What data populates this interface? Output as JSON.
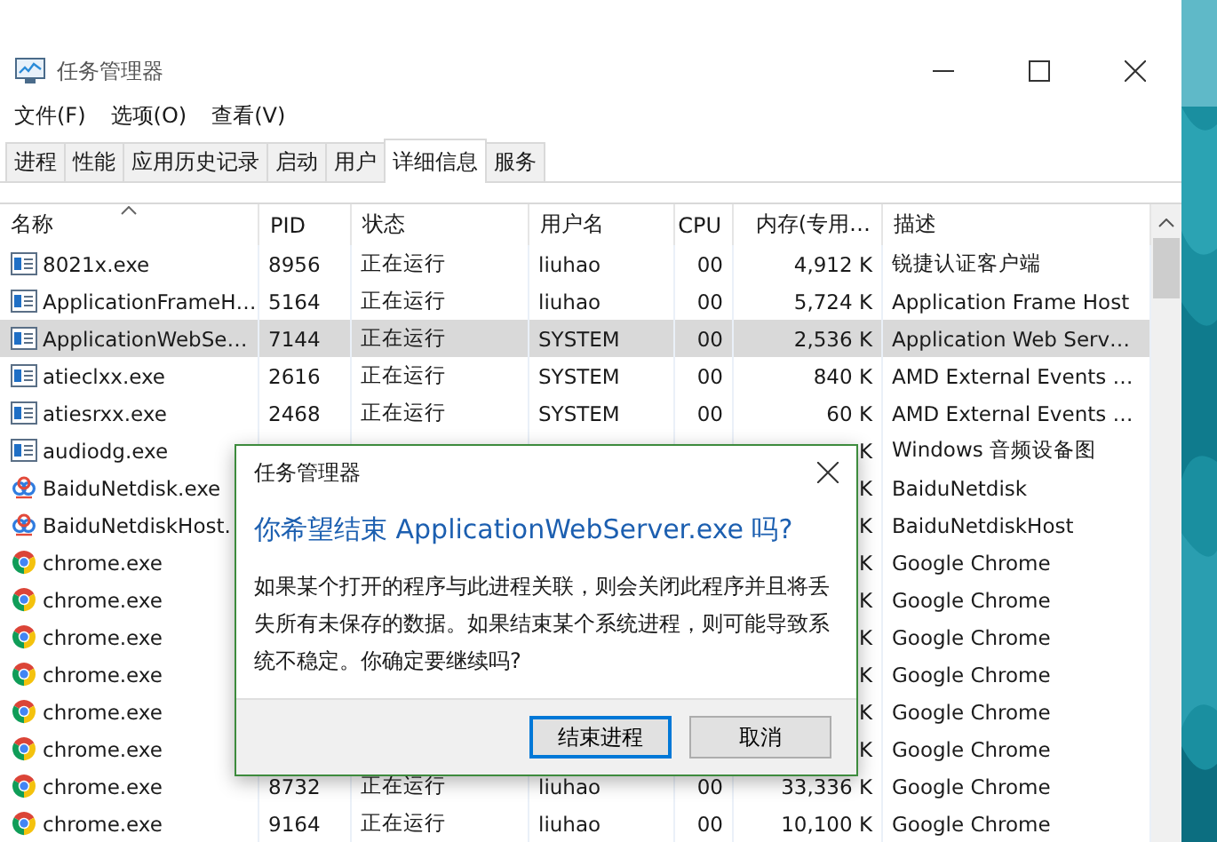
{
  "window": {
    "title": "任务管理器",
    "menu": [
      "文件(F)",
      "选项(O)",
      "查看(V)"
    ]
  },
  "tabs": [
    {
      "label": "进程",
      "selected": false
    },
    {
      "label": "性能",
      "selected": false
    },
    {
      "label": "应用历史记录",
      "selected": false
    },
    {
      "label": "启动",
      "selected": false
    },
    {
      "label": "用户",
      "selected": false
    },
    {
      "label": "详细信息",
      "selected": true
    },
    {
      "label": "服务",
      "selected": false
    }
  ],
  "table": {
    "columns": [
      {
        "label": "名称",
        "sorted": true
      },
      {
        "label": "PID",
        "sorted": false
      },
      {
        "label": "状态",
        "sorted": false
      },
      {
        "label": "用户名",
        "sorted": false
      },
      {
        "label": "CPU",
        "sorted": false
      },
      {
        "label": "内存(专用…",
        "sorted": false
      },
      {
        "label": "描述",
        "sorted": false
      }
    ],
    "rows": [
      {
        "kind": "app",
        "selected": false,
        "cells": [
          "8021x.exe",
          "8956",
          "正在运行",
          "liuhao",
          "00",
          "4,912 K",
          "锐捷认证客户端"
        ]
      },
      {
        "kind": "app",
        "selected": false,
        "cells": [
          "ApplicationFrameH…",
          "5164",
          "正在运行",
          "liuhao",
          "00",
          "5,724 K",
          "Application Frame Host"
        ]
      },
      {
        "kind": "app",
        "selected": true,
        "cells": [
          "ApplicationWebSe…",
          "7144",
          "正在运行",
          "SYSTEM",
          "00",
          "2,536 K",
          "Application Web Serv…"
        ]
      },
      {
        "kind": "app",
        "selected": false,
        "cells": [
          "atieclxx.exe",
          "2616",
          "正在运行",
          "SYSTEM",
          "00",
          "840 K",
          "AMD External Events …"
        ]
      },
      {
        "kind": "app",
        "selected": false,
        "cells": [
          "atiesrxx.exe",
          "2468",
          "正在运行",
          "SYSTEM",
          "00",
          "60 K",
          "AMD External Events …"
        ]
      },
      {
        "kind": "app",
        "selected": false,
        "cells": [
          "audiodg.exe",
          null,
          null,
          null,
          null,
          "K",
          "Windows 音频设备图"
        ]
      },
      {
        "kind": "cloud",
        "selected": false,
        "cells": [
          "BaiduNetdisk.exe",
          null,
          null,
          null,
          null,
          "K",
          "BaiduNetdisk"
        ]
      },
      {
        "kind": "cloud",
        "selected": false,
        "cells": [
          "BaiduNetdiskHost.",
          null,
          null,
          null,
          null,
          "K",
          "BaiduNetdiskHost"
        ]
      },
      {
        "kind": "chrome",
        "selected": false,
        "cells": [
          "chrome.exe",
          null,
          null,
          null,
          null,
          "K",
          "Google Chrome"
        ]
      },
      {
        "kind": "chrome",
        "selected": false,
        "cells": [
          "chrome.exe",
          null,
          null,
          null,
          null,
          "K",
          "Google Chrome"
        ]
      },
      {
        "kind": "chrome",
        "selected": false,
        "cells": [
          "chrome.exe",
          null,
          null,
          null,
          null,
          "K",
          "Google Chrome"
        ]
      },
      {
        "kind": "chrome",
        "selected": false,
        "cells": [
          "chrome.exe",
          null,
          null,
          null,
          null,
          "K",
          "Google Chrome"
        ]
      },
      {
        "kind": "chrome",
        "selected": false,
        "cells": [
          "chrome.exe",
          null,
          null,
          null,
          null,
          "K",
          "Google Chrome"
        ]
      },
      {
        "kind": "chrome",
        "selected": false,
        "cells": [
          "chrome.exe",
          null,
          null,
          null,
          null,
          "K",
          "Google Chrome"
        ]
      },
      {
        "kind": "chrome",
        "selected": false,
        "cells": [
          "chrome.exe",
          "8732",
          "正在运行",
          "liuhao",
          "00",
          "33,336 K",
          "Google Chrome"
        ]
      },
      {
        "kind": "chrome",
        "selected": false,
        "cells": [
          "chrome.exe",
          "9164",
          "正在运行",
          "liuhao",
          "00",
          "10,100 K",
          "Google Chrome"
        ]
      }
    ]
  },
  "dialog": {
    "title": "任务管理器",
    "heading": "你希望结束 ApplicationWebServer.exe 吗?",
    "message": "如果某个打开的程序与此进程关联，则会关闭此程序并且将丢失所有未保存的数据。如果结束某个系统进程，则可能导致系统不稳定。你确定要继续吗?",
    "buttons": [
      {
        "label": "结束进程",
        "default": true
      },
      {
        "label": "取消",
        "default": false
      }
    ]
  }
}
